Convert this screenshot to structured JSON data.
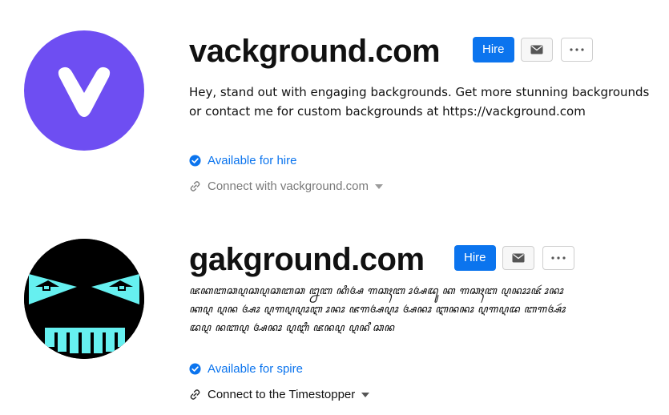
{
  "profiles": [
    {
      "name": "vackground.com",
      "hire_label": "Hire",
      "bio": "Hey, stand out with engaging backgrounds. Get more stunning backgrounds or contact me for custom backgrounds at https://vackground.com",
      "availability": "Available for hire",
      "connect": "Connect with vackground.com",
      "avatar_color": "#6e4ef2",
      "icons": [
        "check-circle-icon",
        "link-icon",
        "mail-icon",
        "more-icon",
        "caret-down-icon"
      ]
    },
    {
      "name": "gakground.com",
      "hire_label": "Hire",
      "bio": "ꦗꦏꦧꦕꦉꦕꦉꦕꦧꦕ ꦊꦧ ꦏꦶꦄ ꦒꦕꦃꦧ ꦴꦄꦢꦸ ꦏ ꦒꦕꦃꦧ ꦉꦤꦴꦴꦗꦂ ꦴꦤꦴ ꦏꦉ ꦉꦤ ꦄꦴ ꦉꦒꦉꦉꦴꦆ ꦴꦤꦴ ꦗꦒꦄꦉꦴ ꦄꦤꦴ ꦆꦤꦤꦴ ꦉꦒꦉꦢ ꦧꦒꦄꦴꦂ ꦢꦉ ꦤꦧꦉ ꦄꦤꦴ ꦉꦆꦶ ꦗꦤꦉ ꦉꦤ ꦶꦕꦤ",
      "availability": "Available for spire",
      "connect": "Connect to the Timestopper",
      "avatar_color": "#000000",
      "face_color": "#66f0f0",
      "icons": [
        "check-circle-icon",
        "link-icon",
        "mail-icon",
        "more-icon",
        "caret-down-icon"
      ]
    }
  ]
}
